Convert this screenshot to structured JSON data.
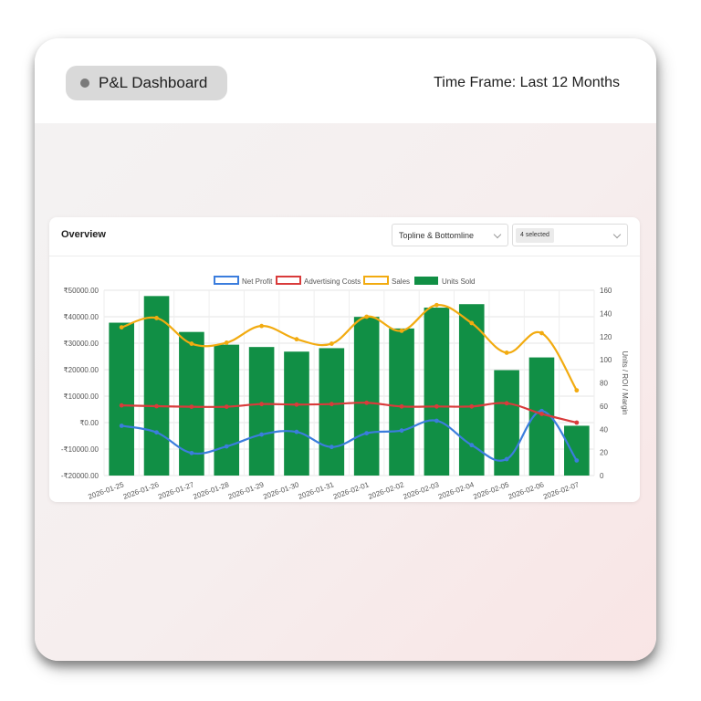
{
  "header": {
    "title": "P&L Dashboard",
    "time_frame": "Time Frame: Last 12 Months"
  },
  "card": {
    "title": "Overview",
    "metric_select": "Topline & Bottomline",
    "filter_select": "4 selected"
  },
  "chart_data": {
    "type": "bar",
    "categories": [
      "2026-01-25",
      "2026-01-26",
      "2026-01-27",
      "2026-01-28",
      "2026-01-29",
      "2026-01-30",
      "2026-01-31",
      "2026-02-01",
      "2026-02-02",
      "2026-02-03",
      "2026-02-04",
      "2026-02-05",
      "2026-02-06",
      "2026-02-07"
    ],
    "left_axis": {
      "min": -20000,
      "max": 50000,
      "step": 10000,
      "tick_labels": [
        "₹50000.00",
        "₹40000.00",
        "₹30000.00",
        "₹20000.00",
        "₹10000.00",
        "₹0.00",
        "-₹10000.00",
        "-₹20000.00"
      ]
    },
    "right_axis": {
      "min": 0,
      "max": 160,
      "step": 20,
      "label": "Units / ROI / Margin",
      "tick_labels": [
        "160",
        "140",
        "120",
        "100",
        "80",
        "60",
        "40",
        "20",
        "0"
      ]
    },
    "grid": true,
    "legend_position": "top",
    "series": [
      {
        "name": "Net Profit",
        "type": "line",
        "axis": "left",
        "color": "#3b7ddd",
        "values": [
          -1200,
          -3700,
          -11500,
          -9000,
          -4500,
          -3500,
          -9200,
          -4000,
          -3000,
          700,
          -8500,
          -13800,
          4400,
          -14300
        ]
      },
      {
        "name": "Advertising Costs",
        "type": "line",
        "axis": "left",
        "color": "#d93b3b",
        "values": [
          6500,
          6200,
          6000,
          6000,
          7000,
          6800,
          7000,
          7500,
          6100,
          6100,
          6100,
          7300,
          3300,
          0
        ]
      },
      {
        "name": "Sales",
        "type": "line",
        "axis": "left",
        "color": "#f2ab10",
        "values": [
          36000,
          39500,
          29800,
          30200,
          36500,
          31500,
          29800,
          40000,
          34700,
          44400,
          37600,
          26400,
          33800,
          12200
        ]
      },
      {
        "name": "Units Sold",
        "type": "bar",
        "axis": "right",
        "color": "#118f45",
        "values": [
          132,
          155,
          124,
          113,
          111,
          107,
          110,
          137,
          127,
          145,
          148,
          91,
          102,
          43
        ]
      }
    ]
  }
}
